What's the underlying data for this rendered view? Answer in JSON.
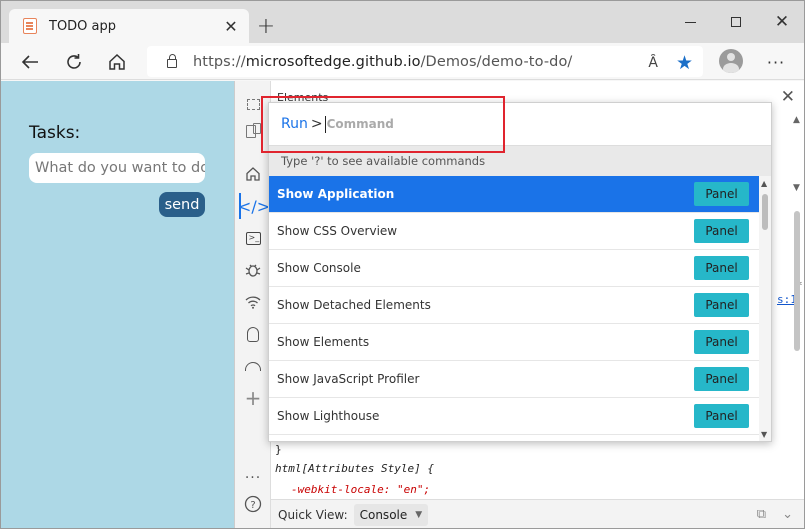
{
  "browser": {
    "tab_title": "TODO app",
    "tab_close": "✕",
    "new_tab": "+",
    "url_prefix": "https://",
    "url_host": "microsoftedge.github.io",
    "url_path": "/Demos/demo-to-do/",
    "read_aloud": "Ȃ",
    "more": "···"
  },
  "page": {
    "tasks_label": "Tasks:",
    "input_placeholder": "What do you want to do",
    "send_label": "send"
  },
  "devtools": {
    "panel_title": "Elements",
    "close": "✕",
    "styles_lines": [
      "}",
      "html[Attributes Style] {",
      "-webkit-locale: \"en\";"
    ],
    "right_fragments": [
      "s:1"
    ],
    "quick_view_label": "Quick View:",
    "quick_view_value": "Console"
  },
  "command_menu": {
    "prompt": "Run",
    "gt": ">",
    "placeholder": "Command",
    "hint": "Type '?' to see available commands",
    "items": [
      {
        "label": "Show Application",
        "badge": "Panel",
        "selected": true
      },
      {
        "label": "Show CSS Overview",
        "badge": "Panel",
        "selected": false
      },
      {
        "label": "Show Console",
        "badge": "Panel",
        "selected": false
      },
      {
        "label": "Show Detached Elements",
        "badge": "Panel",
        "selected": false
      },
      {
        "label": "Show Elements",
        "badge": "Panel",
        "selected": false
      },
      {
        "label": "Show JavaScript Profiler",
        "badge": "Panel",
        "selected": false
      },
      {
        "label": "Show Lighthouse",
        "badge": "Panel",
        "selected": false
      }
    ]
  },
  "colors": {
    "accent": "#1a73e8",
    "page_bg": "#add8e6",
    "send_button": "#2a5f8a",
    "panel_badge": "#26b7c9",
    "highlight": "#e0242e"
  }
}
